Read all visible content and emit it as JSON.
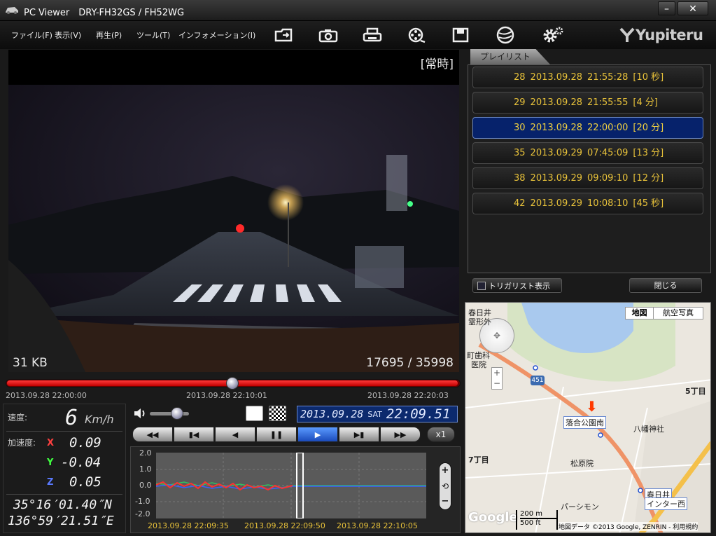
{
  "window": {
    "title": "PC Viewer　DRY-FH32GS / FH52WG",
    "minimize": "–",
    "maximize": "□",
    "close": "✕"
  },
  "menu": [
    "ファイル(F)",
    "表示(V)",
    "再生(P)",
    "ツール(T)",
    "インフォメーション(I)"
  ],
  "toolbar_icons": [
    "folder-icon",
    "camera-icon",
    "print-icon",
    "film-reel-icon",
    "save-icon",
    "globe-icon",
    "settings-gear-icon"
  ],
  "brand": "Yupiteru",
  "video": {
    "mode_label": "[常時]",
    "size_label": "31 KB",
    "frame_counter": "17695 / 35998"
  },
  "seek": {
    "start": "2013.09.28 22:00:00",
    "mid": "2013.09.28 22:10:01",
    "end": "2013.09.28 22:20:03",
    "position": 0.5
  },
  "speed": {
    "label": "速度:",
    "value": "6",
    "unit": "Km/h"
  },
  "accel": {
    "label": "加速度:",
    "x_axis": "X",
    "y_axis": "Y",
    "z_axis": "Z",
    "x": "0.09",
    "y": "-0.04",
    "z": "0.05"
  },
  "gps": {
    "lat": "35°16′01.40″N",
    "lon": "136°59′21.51″E"
  },
  "datetime": {
    "date": "2013.09.28",
    "day": "SAT",
    "time": "22:09.51"
  },
  "playback": {
    "speed_label": "x1",
    "volume": 0.7
  },
  "graph": {
    "y_ticks": [
      "2.0",
      "1.0",
      "0.0",
      "-1.0",
      "-2.0"
    ],
    "x_ticks": [
      "2013.09.28 22:09:35",
      "2013.09.28 22:09:50",
      "2013.09.28 22:10:05"
    ],
    "zoom_in": "+",
    "zoom_reset": "⟲",
    "zoom_out": "−"
  },
  "playlist": {
    "tab": "プレイリスト",
    "items": [
      {
        "num": "28",
        "date": "2013.09.28",
        "time": "21:55:28",
        "dur": "[10 秒]"
      },
      {
        "num": "29",
        "date": "2013.09.28",
        "time": "21:55:55",
        "dur": "[4 分]"
      },
      {
        "num": "30",
        "date": "2013.09.28",
        "time": "22:00:00",
        "dur": "[20 分]"
      },
      {
        "num": "35",
        "date": "2013.09.29",
        "time": "07:45:09",
        "dur": "[13 分]"
      },
      {
        "num": "38",
        "date": "2013.09.29",
        "time": "09:09:10",
        "dur": "[12 分]"
      },
      {
        "num": "42",
        "date": "2013.09.29",
        "time": "10:08:10",
        "dur": "[45 秒]"
      }
    ],
    "selected_index": 2,
    "trigger_list": "トリガリスト表示",
    "close": "閉じる"
  },
  "map": {
    "tab_map": "地図",
    "tab_aerial": "航空写真",
    "labels": [
      "春日井",
      "霊形外",
      "町歯科",
      "医院",
      "5丁目",
      "八幡神社",
      "落合公園南",
      "7丁目",
      "松原院",
      "パーシモン",
      "春日井",
      "インター西"
    ],
    "route_number": "451",
    "scale_m": "200 m",
    "scale_ft": "500 ft",
    "copyright": "地図データ ©2013 Google, ZENRIN - 利用規約",
    "google": "Google",
    "zoom_plus": "+",
    "zoom_minus": "−",
    "marker_glyph": "⬇"
  }
}
